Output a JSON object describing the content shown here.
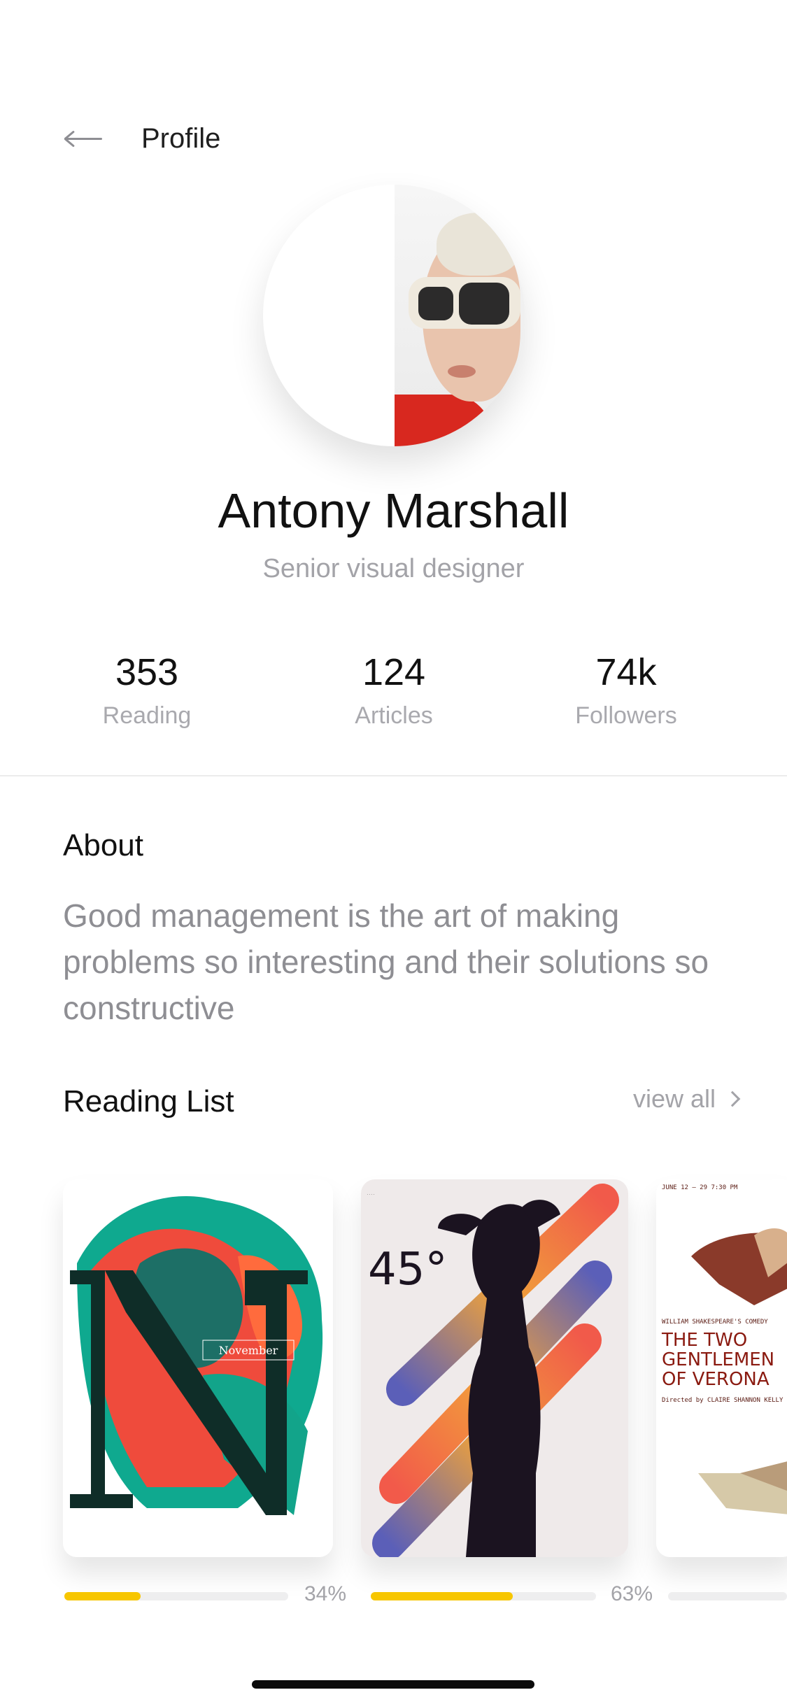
{
  "header": {
    "title": "Profile"
  },
  "profile": {
    "name": "Antony Marshall",
    "title": "Senior visual designer"
  },
  "stats": [
    {
      "value": "353",
      "label": "Reading"
    },
    {
      "value": "124",
      "label": "Articles"
    },
    {
      "value": "74k",
      "label": "Followers"
    }
  ],
  "about": {
    "heading": "About",
    "text": "Good management is the art of making problems so interesting and their solutions so constructive"
  },
  "reading_list": {
    "heading": "Reading List",
    "view_all": "view all",
    "books": [
      {
        "cover_text": "November",
        "progress": 34,
        "progress_label": "34%"
      },
      {
        "cover_text": "45°",
        "progress": 63,
        "progress_label": "63%"
      },
      {
        "cover_lines": [
          "THE TWO",
          "GENTLEMEN",
          "OF VERONA"
        ],
        "cover_small_top": "WILLIAM SHAKESPEARE'S COMEDY",
        "cover_small_bottom": "Directed by CLAIRE SHANNON KELLY",
        "cover_date": "JUNE 12 – 29 7:30 PM"
      }
    ]
  },
  "colors": {
    "accent": "#f7c600",
    "muted": "#a3a3a8",
    "text": "#111111"
  }
}
